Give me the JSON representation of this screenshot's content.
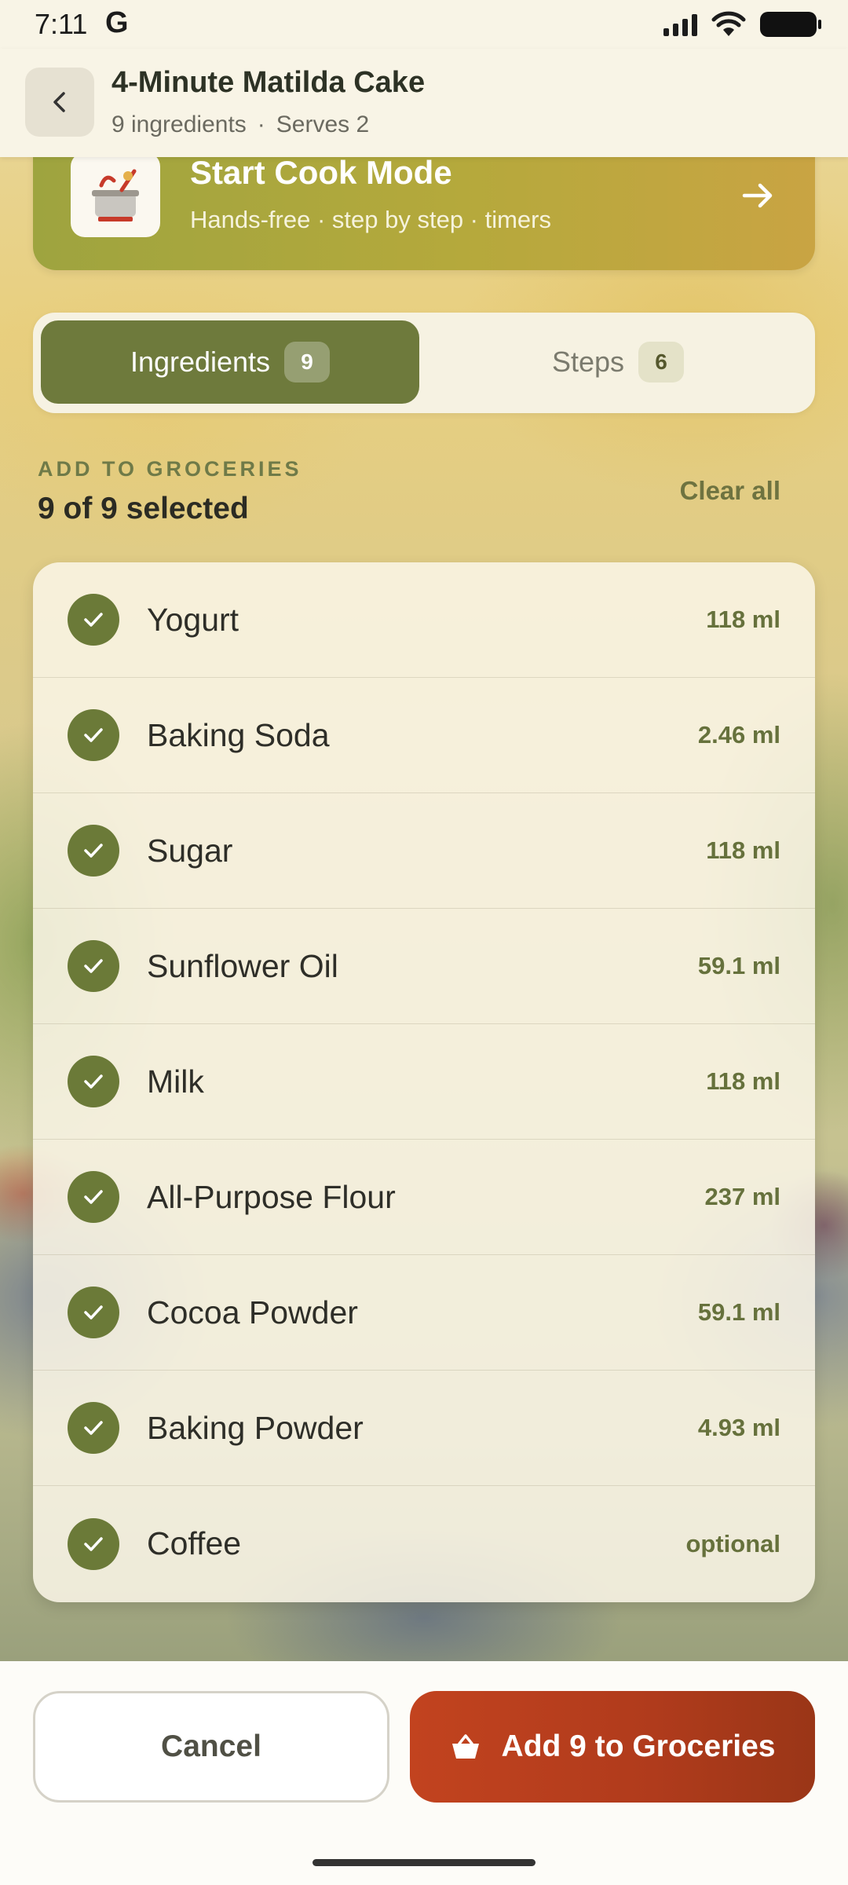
{
  "status_bar": {
    "time": "7:11",
    "g_logo": "G"
  },
  "header": {
    "title": "4-Minute Matilda Cake",
    "ingredients_count_text": "9 ingredients",
    "separator": "·",
    "serves_text": "Serves 2"
  },
  "cook_mode": {
    "title": "Start Cook Mode",
    "subtitle": "Hands-free · step by step · timers",
    "icon": "cooking-pot-icon"
  },
  "tabs": [
    {
      "label": "Ingredients",
      "count": "9",
      "active": true
    },
    {
      "label": "Steps",
      "count": "6",
      "active": false
    }
  ],
  "groceries": {
    "section_label": "ADD TO GROCERIES",
    "selected_text": "9 of 9 selected",
    "clear_all_label": "Clear all"
  },
  "ingredients": [
    {
      "name": "Yogurt",
      "qty": "118 ml",
      "checked": true
    },
    {
      "name": "Baking Soda",
      "qty": "2.46 ml",
      "checked": true
    },
    {
      "name": "Sugar",
      "qty": "118 ml",
      "checked": true
    },
    {
      "name": "Sunflower Oil",
      "qty": "59.1 ml",
      "checked": true
    },
    {
      "name": "Milk",
      "qty": "118 ml",
      "checked": true
    },
    {
      "name": "All-Purpose Flour",
      "qty": "237 ml",
      "checked": true
    },
    {
      "name": "Cocoa Powder",
      "qty": "59.1 ml",
      "checked": true
    },
    {
      "name": "Baking Powder",
      "qty": "4.93 ml",
      "checked": true
    },
    {
      "name": "Coffee",
      "qty": "optional",
      "checked": true
    }
  ],
  "actions": {
    "cancel_label": "Cancel",
    "add_label": "Add 9 to Groceries"
  },
  "colors": {
    "accent_green": "#6e7a3c",
    "add_button": "#b03b1c",
    "cook_banner": "#b5a93c"
  }
}
